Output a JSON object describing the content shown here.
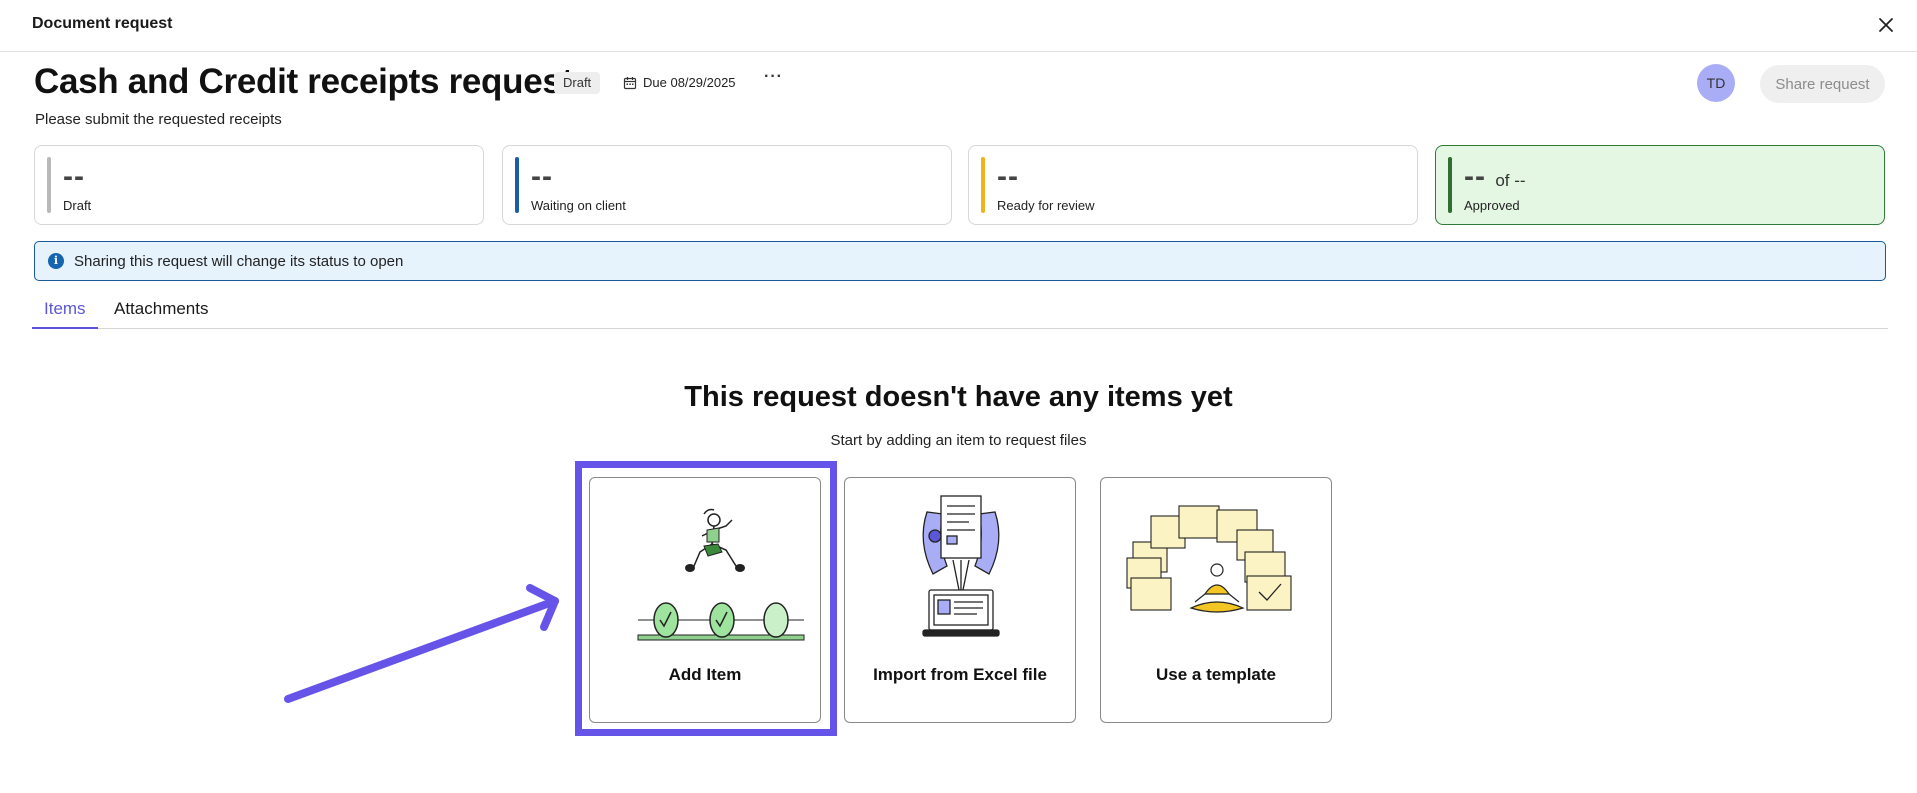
{
  "window": {
    "title": "Document request"
  },
  "header": {
    "title": "Cash and Credit receipts request",
    "status_badge": "Draft",
    "due": "Due 08/29/2025",
    "more": "···",
    "subtitle": "Please submit the requested receipts",
    "avatar_initials": "TD",
    "share_label": "Share request"
  },
  "stats": [
    {
      "value": "--",
      "label": "Draft",
      "color": "#b9b9b9"
    },
    {
      "value": "--",
      "label": "Waiting on client",
      "color": "#1b5fa3"
    },
    {
      "value": "--",
      "label": "Ready for review",
      "color": "#f2b21a"
    },
    {
      "value": "--",
      "of": "of --",
      "label": "Approved",
      "color": "#2f6e33"
    }
  ],
  "banner": {
    "text": "Sharing this request will change its status to open",
    "icon": "info-icon"
  },
  "tabs": [
    {
      "label": "Items",
      "active": true
    },
    {
      "label": "Attachments",
      "active": false
    }
  ],
  "empty_state": {
    "title": "This request doesn't have any items yet",
    "subtitle": "Start by adding an item to request files"
  },
  "options": [
    {
      "label": "Add Item",
      "icon": "runner-hurdles-illustration"
    },
    {
      "label": "Import from Excel file",
      "icon": "laptop-documents-illustration"
    },
    {
      "label": "Use a template",
      "icon": "meditating-person-templates-illustration"
    }
  ],
  "colors": {
    "accent": "#5b57d6",
    "highlight": "#6654e8",
    "banner_border": "#1b5a95",
    "banner_bg": "#e6f3fd",
    "approved_bg": "#e3f7e3"
  }
}
